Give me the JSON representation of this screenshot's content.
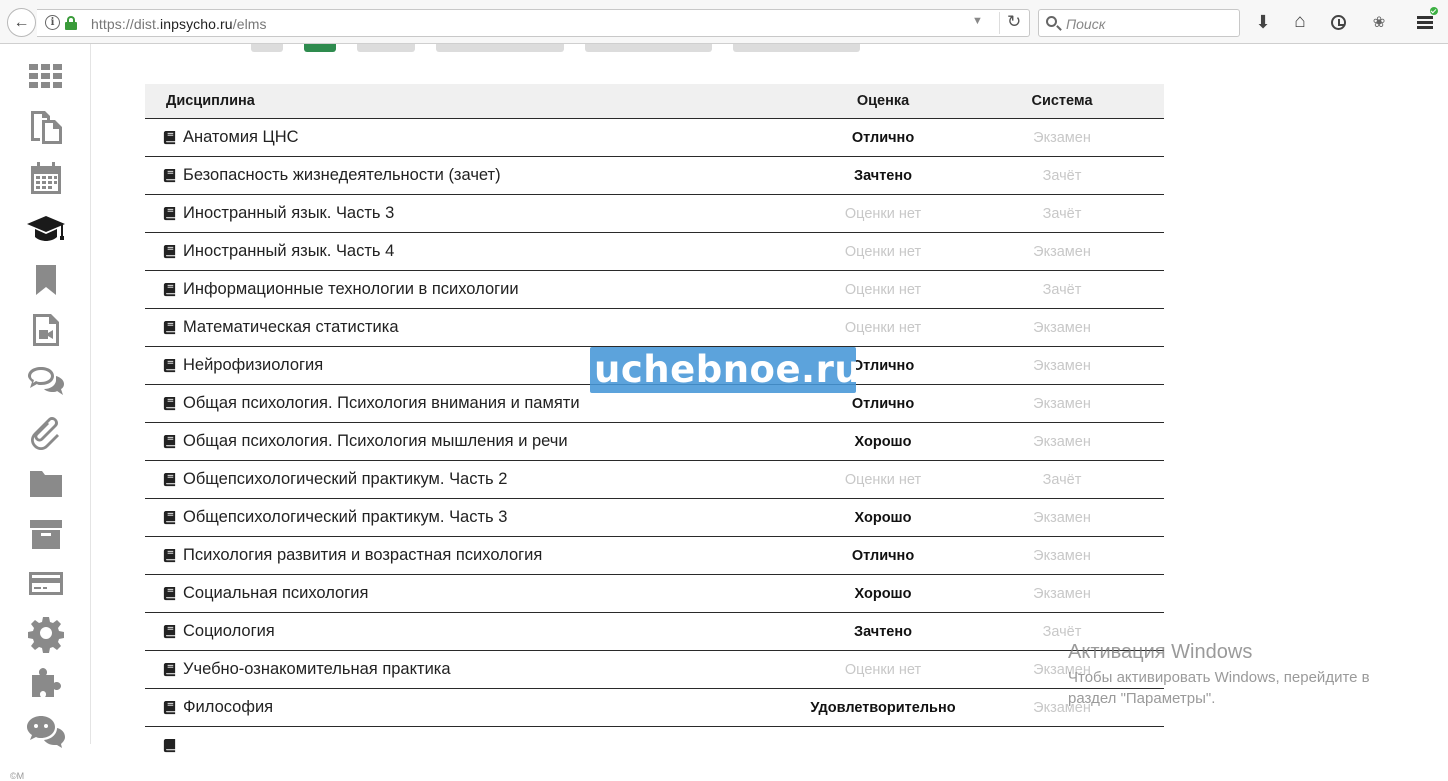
{
  "browser": {
    "url_prefix": "https://dist.",
    "url_domain": "inpsycho.ru",
    "url_path": "/elms",
    "search_placeholder": "Поиск"
  },
  "sidebar": {
    "items": [
      {
        "icon": "apps-grid-icon"
      },
      {
        "icon": "documents-icon"
      },
      {
        "icon": "calendar-icon"
      },
      {
        "icon": "graduation-cap-icon",
        "active": true
      },
      {
        "icon": "bookmark-icon"
      },
      {
        "icon": "video-file-icon"
      },
      {
        "icon": "chat-bubbles-icon"
      },
      {
        "icon": "paperclip-icon"
      },
      {
        "icon": "folder-icon"
      },
      {
        "icon": "archive-box-icon"
      },
      {
        "icon": "credit-card-icon"
      },
      {
        "icon": "gear-icon"
      },
      {
        "icon": "puzzle-icon"
      },
      {
        "icon": "wechat-icon"
      }
    ],
    "copyright": "©M"
  },
  "table": {
    "headers": {
      "discipline": "Дисциплина",
      "grade": "Оценка",
      "system": "Система"
    },
    "rows": [
      {
        "discipline": "Анатомия ЦНС",
        "grade": "Отлично",
        "system": "Экзамен"
      },
      {
        "discipline": "Безопасность жизнедеятельности (зачет)",
        "grade": "Зачтено",
        "system": "Зачёт"
      },
      {
        "discipline": "Иностранный язык. Часть 3",
        "grade": "Оценки нет",
        "system": "Зачёт"
      },
      {
        "discipline": "Иностранный язык. Часть 4",
        "grade": "Оценки нет",
        "system": "Экзамен"
      },
      {
        "discipline": "Информационные технологии в психологии",
        "grade": "Оценки нет",
        "system": "Зачёт"
      },
      {
        "discipline": "Математическая статистика",
        "grade": "Оценки нет",
        "system": "Экзамен"
      },
      {
        "discipline": "Нейрофизиология",
        "grade": "Отлично",
        "system": "Экзамен"
      },
      {
        "discipline": "Общая психология. Психология внимания и памяти",
        "grade": "Отлично",
        "system": "Экзамен"
      },
      {
        "discipline": "Общая психология. Психология мышления и речи",
        "grade": "Хорошо",
        "system": "Экзамен"
      },
      {
        "discipline": "Общепсихологический практикум. Часть 2",
        "grade": "Оценки нет",
        "system": "Зачёт"
      },
      {
        "discipline": "Общепсихологический практикум. Часть 3",
        "grade": "Хорошо",
        "system": "Экзамен"
      },
      {
        "discipline": "Психология развития и возрастная психология",
        "grade": "Отлично",
        "system": "Экзамен"
      },
      {
        "discipline": "Социальная психология",
        "grade": "Хорошо",
        "system": "Экзамен"
      },
      {
        "discipline": "Социология",
        "grade": "Зачтено",
        "system": "Зачёт"
      },
      {
        "discipline": "Учебно-ознакомительная практика",
        "grade": "Оценки нет",
        "system": "Экзамен"
      },
      {
        "discipline": "Философия",
        "grade": "Удовлетворительно",
        "system": "Экзамен"
      }
    ],
    "no_grade_text": "Оценки нет"
  },
  "watermark": "uchebnoe.ru",
  "windows_activation": {
    "title": "Активация Windows",
    "line1": "Чтобы активировать Windows, перейдите в",
    "line2": "раздел \"Параметры\"."
  }
}
